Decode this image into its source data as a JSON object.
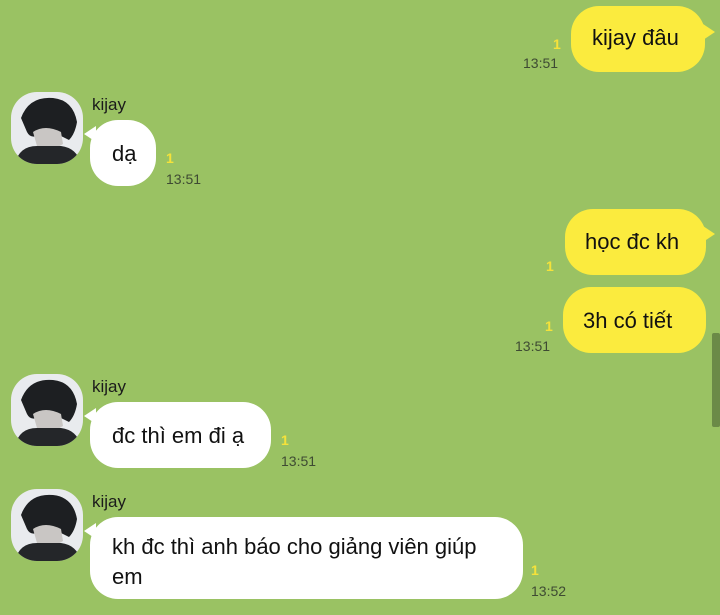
{
  "messages": [
    {
      "id": "m1",
      "direction": "out",
      "text": "kijay đâu",
      "unread": "1",
      "time": "13:51"
    },
    {
      "id": "m2",
      "direction": "in",
      "sender": "kijay",
      "text": "dạ",
      "unread": "1",
      "time": "13:51"
    },
    {
      "id": "m3",
      "direction": "out",
      "text": "học đc kh",
      "unread": "1",
      "time": ""
    },
    {
      "id": "m4",
      "direction": "out",
      "text": "3h có tiết",
      "unread": "1",
      "time": "13:51"
    },
    {
      "id": "m5",
      "direction": "in",
      "sender": "kijay",
      "text": "đc thì em đi ạ",
      "unread": "1",
      "time": "13:51"
    },
    {
      "id": "m6",
      "direction": "in",
      "sender": "kijay",
      "text": "kh đc thì anh báo cho giảng viên giúp em",
      "unread": "1",
      "time": "13:52"
    }
  ],
  "colors": {
    "background": "#9ac263",
    "outgoing_bubble": "#fbeb3e",
    "incoming_bubble": "#ffffff",
    "unread_counter": "#f5e23a"
  },
  "icons": {
    "avatar": "user-avatar-photo"
  }
}
